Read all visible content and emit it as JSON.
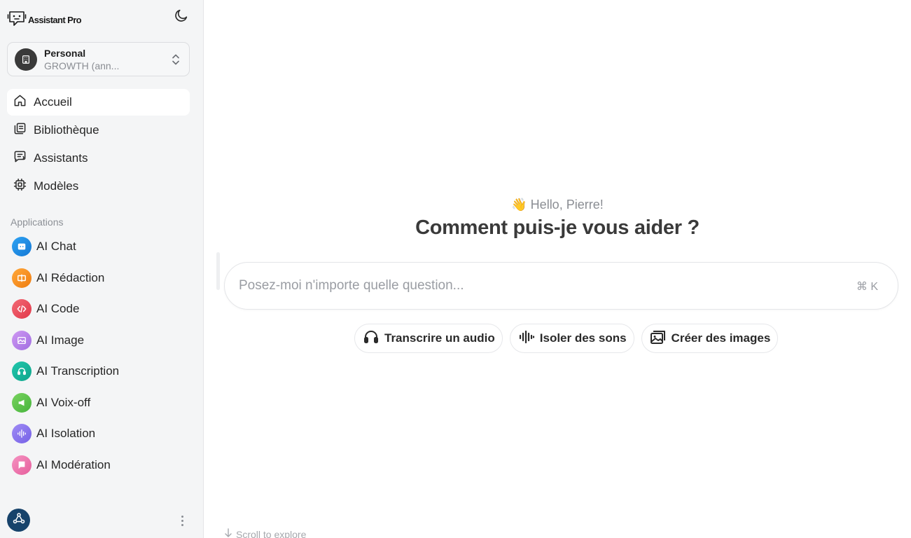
{
  "app": {
    "title": "Assistant Pro"
  },
  "workspace": {
    "name": "Personal",
    "plan": "GROWTH (ann..."
  },
  "nav": [
    {
      "label": "Accueil",
      "icon": "home-icon",
      "active": true
    },
    {
      "label": "Bibliothèque",
      "icon": "library-icon"
    },
    {
      "label": "Assistants",
      "icon": "assistant-icon"
    },
    {
      "label": "Modèles",
      "icon": "chip-icon"
    }
  ],
  "apps": {
    "title": "Applications",
    "items": [
      {
        "label": "AI Chat",
        "icon": "chat-icon",
        "color": "#1d8fe6"
      },
      {
        "label": "AI Rédaction",
        "icon": "writing-icon",
        "color": "#f28a1c"
      },
      {
        "label": "AI Code",
        "icon": "code-icon",
        "color": "#ec4a57"
      },
      {
        "label": "AI Image",
        "icon": "image-icon",
        "color": "#b57de8"
      },
      {
        "label": "AI Transcription",
        "icon": "headphones-icon",
        "color": "#15b79b"
      },
      {
        "label": "AI Voix-off",
        "icon": "megaphone-icon",
        "color": "#5cc451"
      },
      {
        "label": "AI Isolation",
        "icon": "waveform-icon",
        "color": "#8a73ee"
      },
      {
        "label": "AI Modération",
        "icon": "flag-icon",
        "color": "#ef6fa8"
      }
    ]
  },
  "main": {
    "greeting": "👋 Hello, Pierre!",
    "headline": "Comment puis-je vous aider ?",
    "search_placeholder": "Posez-moi n'importe quelle question...",
    "shortcut": "⌘ K",
    "actions": [
      {
        "label": "Transcrire un audio",
        "icon": "headphones-icon"
      },
      {
        "label": "Isoler des sons",
        "icon": "waveform-icon"
      },
      {
        "label": "Créer des images",
        "icon": "image-icon"
      }
    ],
    "scroll_hint": "Scroll to explore"
  }
}
